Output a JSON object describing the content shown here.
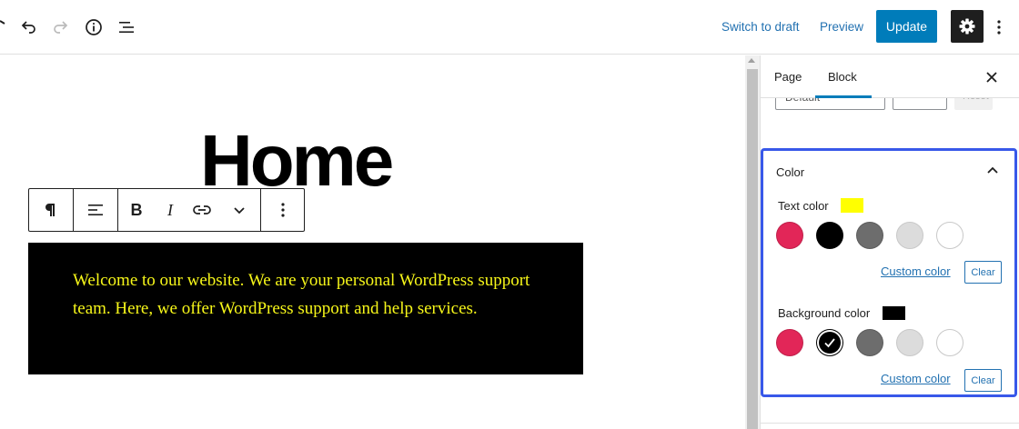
{
  "topbar": {
    "switch_to_draft": "Switch to draft",
    "preview": "Preview",
    "update": "Update",
    "icons": [
      "tools-icon",
      "undo-icon",
      "redo-icon",
      "info-icon",
      "list-view-icon",
      "gear-icon",
      "more-options-icon"
    ],
    "accent": "#007cba"
  },
  "editor": {
    "page_title": "Home",
    "paragraph": {
      "text": "Welcome to our website. We are your personal WordPress support team. Here, we offer WordPress support and help services.",
      "text_color": "#f7f719",
      "background_color": "#000000"
    },
    "block_toolbar": {
      "icons": [
        "paragraph-icon",
        "align-icon",
        "bold-icon",
        "italic-icon",
        "link-icon",
        "chevron-down-icon",
        "more-options-icon"
      ],
      "bold": "B",
      "italic": "I"
    }
  },
  "sidebar": {
    "tabs": [
      {
        "label": "Page",
        "active": false
      },
      {
        "label": "Block",
        "active": true
      }
    ],
    "partial_select_text": "Default",
    "partial_reset_text": "Reset",
    "color_panel": {
      "title": "Color",
      "text_color": {
        "label": "Text color",
        "current": "#ffff00",
        "swatches": [
          "#e22658",
          "#000000",
          "#6d6d6d",
          "#dcdcdc",
          "#ffffff"
        ],
        "selected_index": -1,
        "custom_link": "Custom color",
        "clear": "Clear"
      },
      "background_color": {
        "label": "Background color",
        "current": "#000000",
        "swatches": [
          "#e22658",
          "#000000",
          "#6d6d6d",
          "#dcdcdc",
          "#ffffff"
        ],
        "selected_index": 1,
        "custom_link": "Custom color",
        "clear": "Clear"
      }
    }
  }
}
